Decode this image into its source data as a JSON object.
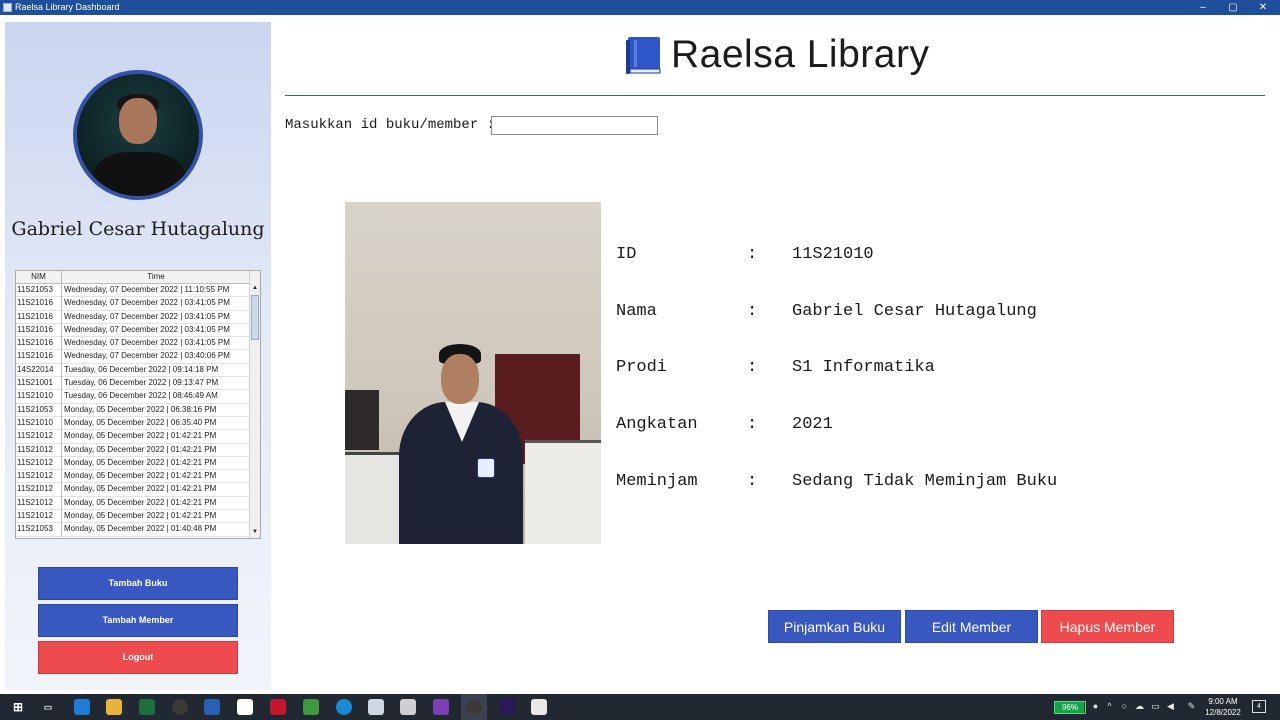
{
  "window": {
    "title": "Raelsa Library Dashboard",
    "controls": {
      "minimize": "–",
      "maximize": "▢",
      "close": "✕"
    }
  },
  "sidebar": {
    "user_name": "Gabriel Cesar Hutagalung",
    "log_table": {
      "columns": [
        "NIM",
        "Time"
      ],
      "rows": [
        [
          "11S21053",
          "Wednesday, 07 December 2022 | 11:10:55 PM"
        ],
        [
          "11S21016",
          "Wednesday, 07 December 2022 | 03:41:05 PM"
        ],
        [
          "11S21016",
          "Wednesday, 07 December 2022 | 03:41:05 PM"
        ],
        [
          "11S21016",
          "Wednesday, 07 December 2022 | 03:41:05 PM"
        ],
        [
          "11S21016",
          "Wednesday, 07 December 2022 | 03:41:05 PM"
        ],
        [
          "11S21016",
          "Wednesday, 07 December 2022 | 03:40:06 PM"
        ],
        [
          "14S22014",
          "Tuesday, 06 December 2022 | 09:14:18 PM"
        ],
        [
          "11S21001",
          "Tuesday, 06 December 2022 | 09:13:47 PM"
        ],
        [
          "11S21010",
          "Tuesday, 06 December 2022 | 08:46:49 AM"
        ],
        [
          "11S21053",
          "Monday, 05 December 2022 | 06:38:16 PM"
        ],
        [
          "11S21010",
          "Monday, 05 December 2022 | 06:35:40 PM"
        ],
        [
          "11S21012",
          "Monday, 05 December 2022 | 01:42:21 PM"
        ],
        [
          "11S21012",
          "Monday, 05 December 2022 | 01:42:21 PM"
        ],
        [
          "11S21012",
          "Monday, 05 December 2022 | 01:42:21 PM"
        ],
        [
          "11S21012",
          "Monday, 05 December 2022 | 01:42:21 PM"
        ],
        [
          "11S21012",
          "Monday, 05 December 2022 | 01:42:21 PM"
        ],
        [
          "11S21012",
          "Monday, 05 December 2022 | 01:42:21 PM"
        ],
        [
          "11S21012",
          "Monday, 05 December 2022 | 01:42:21 PM"
        ],
        [
          "11S21053",
          "Monday, 05 December 2022 | 01:40:48 PM"
        ]
      ]
    },
    "buttons": {
      "tambah_buku": "Tambah Buku",
      "tambah_member": "Tambah Member",
      "logout": "Logout"
    }
  },
  "header": {
    "title": "Raelsa Library",
    "icon": "book-icon"
  },
  "search": {
    "label": "Masukkan id buku/member :",
    "value": ""
  },
  "member": {
    "fields": [
      {
        "key": "ID",
        "value": "11S21010"
      },
      {
        "key": "Nama",
        "value": "Gabriel Cesar Hutagalung"
      },
      {
        "key": "Prodi",
        "value": "S1 Informatika"
      },
      {
        "key": "Angkatan",
        "value": "2021"
      },
      {
        "key": "Meminjam",
        "value": "Sedang Tidak Meminjam Buku"
      }
    ],
    "separator": ":"
  },
  "actions": {
    "pinjamkan": "Pinjamkan Buku",
    "edit": "Edit Member",
    "hapus": "Hapus Member"
  },
  "taskbar": {
    "battery": "96%",
    "battery_level": 0.96,
    "time": "9:00 AM",
    "date": "12/8/2022",
    "notifications": "4"
  },
  "colors": {
    "primary": "#3858c0",
    "danger": "#ee4b4f",
    "titlebar": "#1f4e9a"
  }
}
